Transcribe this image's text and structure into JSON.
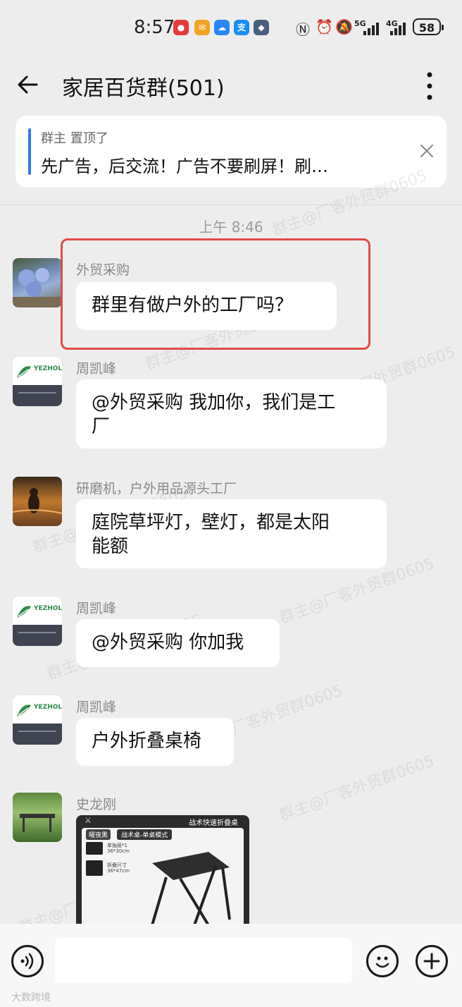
{
  "status_bar": {
    "time": "8:57",
    "battery": "58",
    "net1": "5G",
    "net2": "4G",
    "app_icons": [
      "mail-app-icon",
      "email-icon",
      "weather-icon",
      "alipay-icon",
      "game-icon"
    ]
  },
  "header": {
    "title": "家居百货群(501)"
  },
  "pinned": {
    "meta": "群主 置顶了",
    "text": "先广告，后交流！广告不要刷屏！刷…"
  },
  "timestamp": "上午 8:46",
  "messages": [
    {
      "sender": "外贸采购",
      "text": "群里有做户外的工厂吗？"
    },
    {
      "sender": "周凯峰",
      "line1": "@外贸采购 我加你，我们是工",
      "line2": "厂"
    },
    {
      "sender": "研磨机，户外用品源头工厂",
      "line1": "庭院草坪灯，壁灯，都是太阳",
      "line2": "能额"
    },
    {
      "sender": "周凯峰",
      "text": "@外贸采购 你加我"
    },
    {
      "sender": "周凯峰",
      "text": "户外折叠桌椅"
    },
    {
      "sender": "史龙刚"
    }
  ],
  "image_msg": {
    "title": "战术快速折叠桌",
    "badge": "曜夜黑",
    "mode": "战术桌-单桌模式",
    "spec1": "单抽层*1",
    "spec1b": "36*30cm",
    "spec2": "拆叠尺寸",
    "spec2b": "36*47cm"
  },
  "avatar_logo_text": "YEZHOLIN",
  "watermark": "群主@厂客外贸群0605",
  "corner_text": "大数跨境",
  "colors": {
    "accent": "#2a7ee8",
    "highlight": "#e24a4a",
    "bg": "#ededed"
  }
}
